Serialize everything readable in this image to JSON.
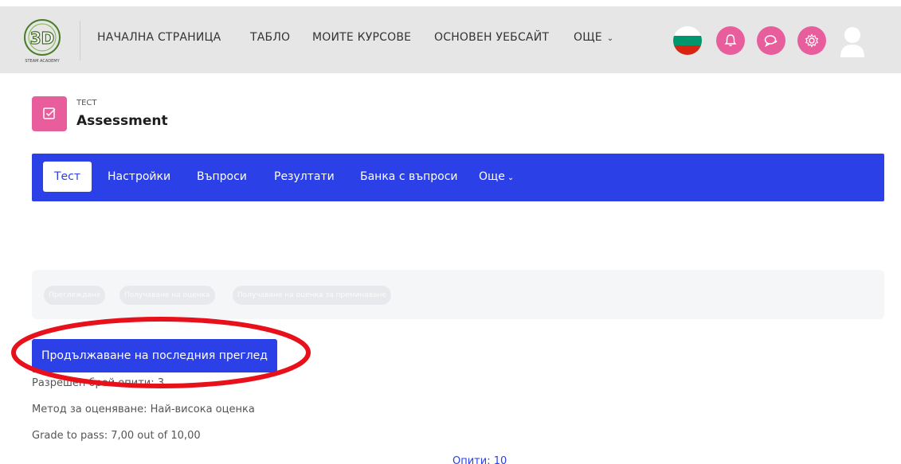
{
  "header": {
    "logo_alt": "3D STEAM ACADEMY",
    "nav": [
      {
        "label": "НАЧАЛНА СТРАНИЦА"
      },
      {
        "label": "ТАБЛО"
      },
      {
        "label": "МОИТЕ КУРСОВЕ"
      },
      {
        "label": "ОСНОВЕН УЕБСАЙТ"
      },
      {
        "label": "ОЩЕ",
        "caret": "⌄"
      }
    ],
    "icons": [
      "bulgaria-flag-icon",
      "bell-icon",
      "chat-icon",
      "gear-icon",
      "user-avatar-icon"
    ],
    "colors": {
      "bar": "#e6e6e6",
      "accent_pink": "#e85d9c"
    }
  },
  "activity": {
    "type": "ТЕСТ",
    "title": "Assessment",
    "icon": "checkbox-icon"
  },
  "secondary_nav": {
    "tabs": [
      {
        "label": "Тест",
        "active": true
      },
      {
        "label": "Настройки"
      },
      {
        "label": "Въпроси"
      },
      {
        "label": "Резултати"
      },
      {
        "label": "Банка с въпроси"
      },
      {
        "label": "Още",
        "caret": "⌄"
      }
    ],
    "color": "#2b40e6"
  },
  "completion": {
    "conditions": [
      "Преглеждане",
      "Получаване на оценка",
      "Получаване на оценка за преминаване"
    ]
  },
  "main": {
    "continue_button": "Продължаване на последния преглед",
    "attempts_allowed": "Разрешен брой опити: 3",
    "grading_method": "Метод за оценяване: Най-висока оценка",
    "grade_to_pass": "Grade to pass: 7,00 out of 10,00",
    "attempts_link": "Опити: 10"
  },
  "annotation": {
    "type": "red-ellipse",
    "color": "#e8101a"
  }
}
